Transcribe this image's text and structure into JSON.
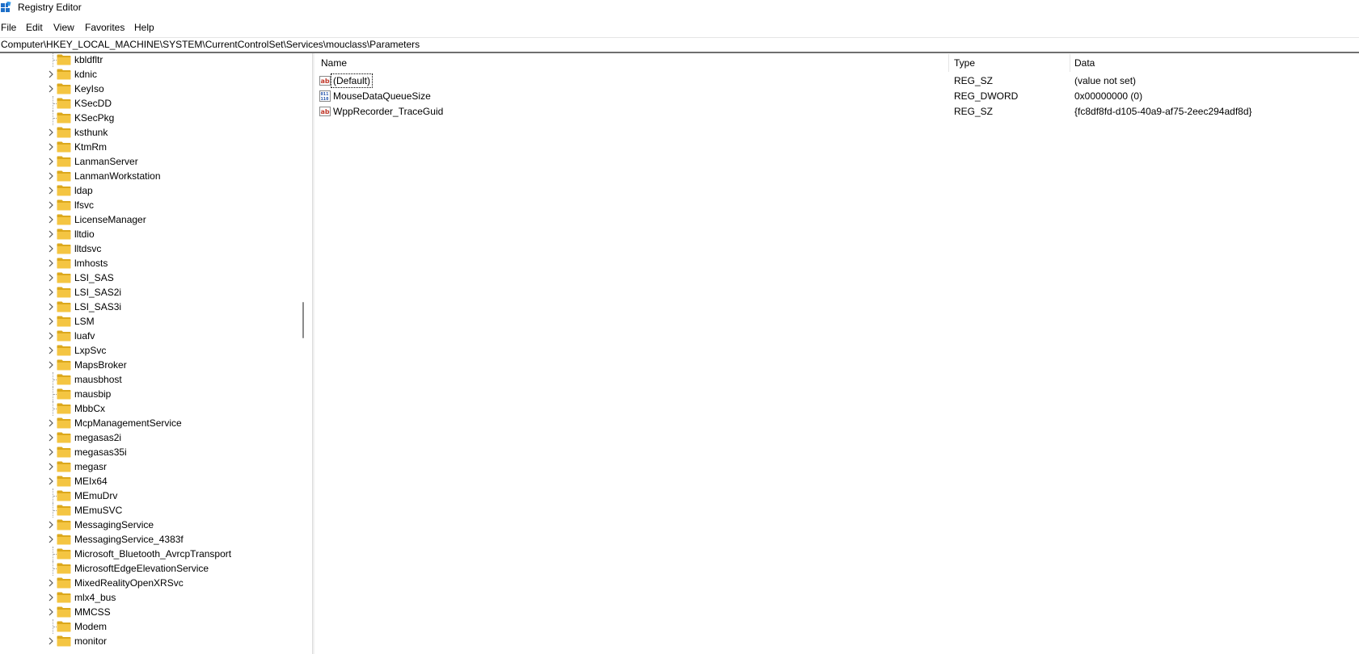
{
  "window": {
    "title": "Registry Editor"
  },
  "menu": [
    "File",
    "Edit",
    "View",
    "Favorites",
    "Help"
  ],
  "address": "Computer\\HKEY_LOCAL_MACHINE\\SYSTEM\\CurrentControlSet\\Services\\mouclass\\Parameters",
  "tree": [
    {
      "label": "kbldfltr",
      "expandable": false
    },
    {
      "label": "kdnic",
      "expandable": true
    },
    {
      "label": "KeyIso",
      "expandable": true
    },
    {
      "label": "KSecDD",
      "expandable": false
    },
    {
      "label": "KSecPkg",
      "expandable": false
    },
    {
      "label": "ksthunk",
      "expandable": true
    },
    {
      "label": "KtmRm",
      "expandable": true
    },
    {
      "label": "LanmanServer",
      "expandable": true
    },
    {
      "label": "LanmanWorkstation",
      "expandable": true
    },
    {
      "label": "ldap",
      "expandable": true
    },
    {
      "label": "lfsvc",
      "expandable": true
    },
    {
      "label": "LicenseManager",
      "expandable": true
    },
    {
      "label": "lltdio",
      "expandable": true
    },
    {
      "label": "lltdsvc",
      "expandable": true
    },
    {
      "label": "lmhosts",
      "expandable": true
    },
    {
      "label": "LSI_SAS",
      "expandable": true
    },
    {
      "label": "LSI_SAS2i",
      "expandable": true
    },
    {
      "label": "LSI_SAS3i",
      "expandable": true
    },
    {
      "label": "LSM",
      "expandable": true
    },
    {
      "label": "luafv",
      "expandable": true
    },
    {
      "label": "LxpSvc",
      "expandable": true
    },
    {
      "label": "MapsBroker",
      "expandable": true
    },
    {
      "label": "mausbhost",
      "expandable": false
    },
    {
      "label": "mausbip",
      "expandable": false
    },
    {
      "label": "MbbCx",
      "expandable": false
    },
    {
      "label": "McpManagementService",
      "expandable": true
    },
    {
      "label": "megasas2i",
      "expandable": true
    },
    {
      "label": "megasas35i",
      "expandable": true
    },
    {
      "label": "megasr",
      "expandable": true
    },
    {
      "label": "MEIx64",
      "expandable": true
    },
    {
      "label": "MEmuDrv",
      "expandable": false
    },
    {
      "label": "MEmuSVC",
      "expandable": false
    },
    {
      "label": "MessagingService",
      "expandable": true
    },
    {
      "label": "MessagingService_4383f",
      "expandable": true
    },
    {
      "label": "Microsoft_Bluetooth_AvrcpTransport",
      "expandable": false
    },
    {
      "label": "MicrosoftEdgeElevationService",
      "expandable": false
    },
    {
      "label": "MixedRealityOpenXRSvc",
      "expandable": true
    },
    {
      "label": "mlx4_bus",
      "expandable": true
    },
    {
      "label": "MMCSS",
      "expandable": true
    },
    {
      "label": "Modem",
      "expandable": false
    },
    {
      "label": "monitor",
      "expandable": true
    }
  ],
  "columns": {
    "name": "Name",
    "type": "Type",
    "data": "Data"
  },
  "values": [
    {
      "name": "(Default)",
      "type": "REG_SZ",
      "data": "(value not set)",
      "icon": "string-value-icon"
    },
    {
      "name": "MouseDataQueueSize",
      "type": "REG_DWORD",
      "data": "0x00000000 (0)",
      "icon": "binary-value-icon"
    },
    {
      "name": "WppRecorder_TraceGuid",
      "type": "REG_SZ",
      "data": "{fc8df8fd-d105-40a9-af75-2eec294adf8d}",
      "icon": "string-value-icon"
    }
  ],
  "colors": {
    "folder": "#f4c542",
    "folder_dark": "#dca81c",
    "separator": "#6f6f6f"
  }
}
